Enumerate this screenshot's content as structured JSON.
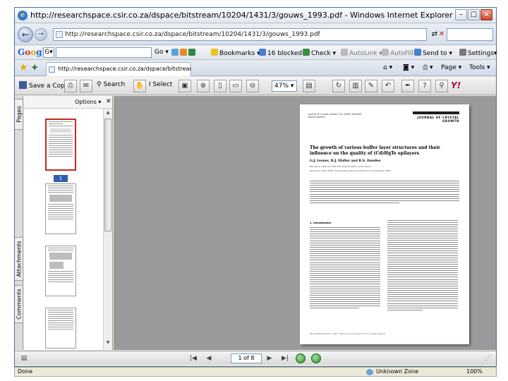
{
  "window": {
    "title": "http://researchspace.csir.co.za/dspace/bitstream/10204/1431/3/gouws_1993.pdf - Windows Internet Explorer"
  },
  "address_bar": {
    "url": "http://researchspace.csir.co.za/dspace/bitstream/10204/1431/3/gouws_1993.pdf"
  },
  "google_toolbar": {
    "logo": "Google",
    "go_label": "Go",
    "bookmarks_label": "Bookmarks",
    "blocked_label": "16 blocked",
    "check_label": "Check",
    "autolink_label": "AutoLink",
    "autofill_label": "AutoFill",
    "sendto_label": "Send to",
    "settings_label": "Settings"
  },
  "tabs": {
    "active_tab": "http://researchspace.csir.co.za/dspace/bitstream/10...",
    "page_label": "Page",
    "tools_label": "Tools"
  },
  "pdf_toolbar": {
    "save_copy_label": "Save a Copy",
    "search_label": "Search",
    "select_label": "Select",
    "zoom_value": "47%"
  },
  "side_tabs": {
    "pages": "Pages",
    "attachments": "Attachments",
    "comments": "Comments"
  },
  "thumbnail_panel": {
    "options_label": "Options",
    "selected_page_label": "1"
  },
  "document": {
    "header_left": "Journal of Crystal Growth 131 (1993) 000-000 North-Holland",
    "journal_name": "JOURNAL OF CRYSTAL GROWTH",
    "title": "The growth of various buffer layer structures and their influence on the quality of (Cd)HgTe epilayers",
    "authors": "G.J. Gouws, R.J. Muller and R.S. Dowdee",
    "affiliation": "Microtech, CSIR, P.O. Box 395, Pretoria 0001, South Africa",
    "received": "Received 7 April 1993; manuscript received in final form 21 December 1993",
    "section_heading": "1. Introduction",
    "footer": "0022-0248/93/$06.00 © 1993 - Elsevier Science Publishers B.V. All rights reserved"
  },
  "pdf_bottom": {
    "page_indicator": "1 of 8"
  },
  "status_bar": {
    "status_text": "Done",
    "zone_text": "Unknown Zone",
    "zoom_text": "100%"
  },
  "colors": {
    "selection_red": "#c8281e",
    "thumbnail_label_blue": "#2f5fae",
    "yahoo_red": "#b0082c"
  }
}
